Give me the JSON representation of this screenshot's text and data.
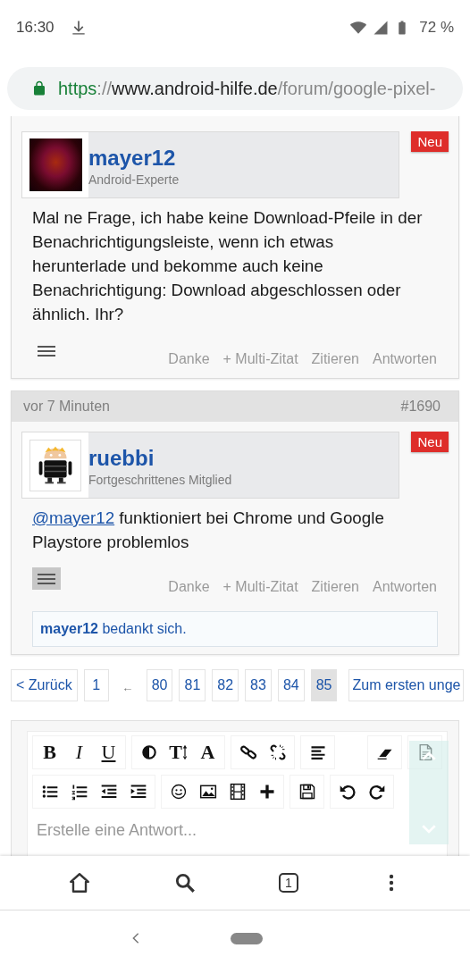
{
  "status_bar": {
    "time": "16:30",
    "battery": "72 %"
  },
  "address_bar": {
    "scheme": "https",
    "separator": "://",
    "host": "www.android-hilfe.de",
    "path": "/forum/google-pixel-"
  },
  "posts": [
    {
      "username": "mayer12",
      "rank": "Android-Experte",
      "badge": "Neu",
      "avatar": {
        "kind": "photo"
      },
      "message": "Mal ne Frage, ich habe keine Download-Pfeile in der Benachrichtigungsleiste, wenn ich etwas herunterlade und bekomme auch keine Benachrichtigung: Download abgeschlossen oder ähnlich. Ihr?",
      "menu_pressed": false,
      "actions": [
        "Danke",
        "+ Multi-Zitat",
        "Zitieren",
        "Antworten"
      ]
    },
    {
      "time": "vor 7 Minuten",
      "number": "#1690",
      "username": "ruebbi",
      "rank": "Fortgeschrittenes Mitglied",
      "badge": "Neu",
      "avatar": {
        "kind": "robot"
      },
      "mention": "@mayer12",
      "message": "funktioniert bei Chrome und Google Playstore problemlos",
      "menu_pressed": true,
      "actions": [
        "Danke",
        "+ Multi-Zitat",
        "Zitieren",
        "Antworten"
      ],
      "thanks": "**mayer12** bedankt sich."
    }
  ],
  "pagination": [
    {
      "kind": "prev",
      "label": "< Zurück",
      "selected": false
    },
    {
      "kind": "page",
      "label": "1",
      "selected": false
    },
    {
      "kind": "gap",
      "label": "←",
      "selected": false
    },
    {
      "kind": "page",
      "label": "80",
      "selected": false
    },
    {
      "kind": "page",
      "label": "81",
      "selected": false
    },
    {
      "kind": "page",
      "label": "82",
      "selected": false
    },
    {
      "kind": "page",
      "label": "83",
      "selected": false
    },
    {
      "kind": "page",
      "label": "84",
      "selected": false
    },
    {
      "kind": "page",
      "label": "85",
      "selected": true
    },
    {
      "kind": "next",
      "label": "Zum ersten unge",
      "selected": false
    }
  ],
  "editor": {
    "toolbar": [
      [
        [
          {
            "kind": "bold",
            "label": "B"
          },
          {
            "kind": "italic",
            "label": "I"
          },
          {
            "kind": "underline",
            "label": "U"
          }
        ],
        [
          {
            "kind": "contrast"
          },
          {
            "kind": "fontsize",
            "label": "T"
          },
          {
            "kind": "fontcolor",
            "label": "A"
          }
        ],
        [
          {
            "kind": "link"
          },
          {
            "kind": "unlink"
          }
        ],
        [
          {
            "kind": "align"
          }
        ],
        [
          {
            "kind": "eraser"
          }
        ],
        [
          {
            "kind": "source"
          }
        ]
      ],
      [
        [
          {
            "kind": "bullets"
          },
          {
            "kind": "numbers"
          },
          {
            "kind": "outdent"
          },
          {
            "kind": "indent"
          }
        ],
        [
          {
            "kind": "smiley"
          },
          {
            "kind": "image"
          },
          {
            "kind": "video"
          },
          {
            "kind": "plus"
          }
        ],
        [
          {
            "kind": "save"
          }
        ],
        [
          {
            "kind": "undo"
          },
          {
            "kind": "redo"
          }
        ]
      ]
    ],
    "placeholder": "Erstelle eine Antwort..."
  },
  "bottom_nav": {
    "tab_count": "1"
  }
}
